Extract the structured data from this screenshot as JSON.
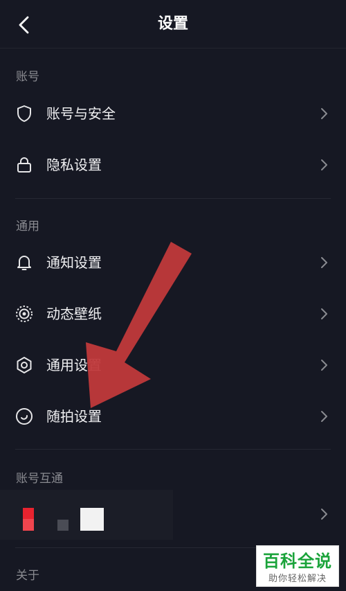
{
  "header": {
    "title": "设置",
    "back_icon": "chevron-left-icon"
  },
  "sections": [
    {
      "label": "账号",
      "items": [
        {
          "label": "账号与安全",
          "icon": "shield-icon"
        },
        {
          "label": "隐私设置",
          "icon": "lock-icon"
        }
      ]
    },
    {
      "label": "通用",
      "items": [
        {
          "label": "通知设置",
          "icon": "bell-icon"
        },
        {
          "label": "动态壁纸",
          "icon": "live-wallpaper-icon"
        },
        {
          "label": "通用设置",
          "icon": "gear-icon"
        },
        {
          "label": "随拍设置",
          "icon": "snapshot-icon"
        }
      ]
    },
    {
      "label": "账号互通",
      "items": []
    },
    {
      "label": "关于",
      "items": []
    }
  ],
  "colors": {
    "background": "#161823",
    "text": "#f0f0f2",
    "secondary_text": "#8a8b91",
    "arrow": "#c0393b",
    "watermark_green": "#1aa33a"
  },
  "watermark": {
    "main": "百科全说",
    "sub": "助你轻松解决"
  }
}
